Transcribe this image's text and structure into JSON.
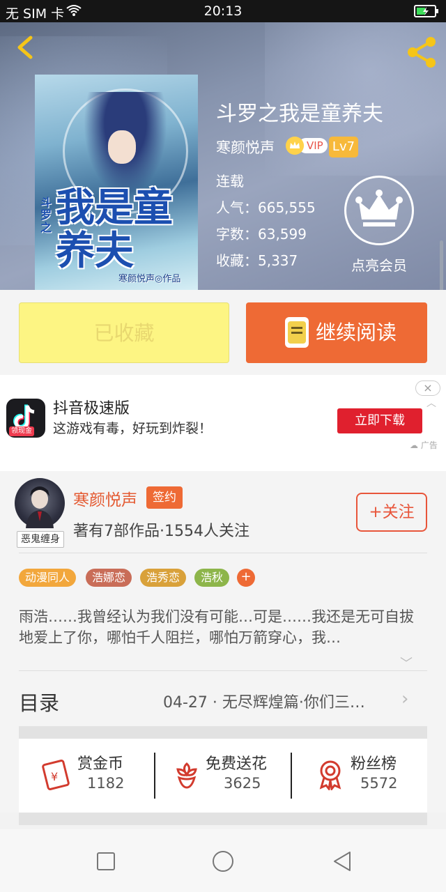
{
  "status_bar": {
    "carrier": "无 SIM 卡",
    "time": "20:13"
  },
  "book": {
    "title": "斗罗之我是童养夫",
    "author": "寒颜悦声",
    "vip_label": "VIP",
    "level": "Lv7",
    "status": "连载",
    "popularity": "人气：665,555",
    "word_count": "字数：63,599",
    "favorites": "收藏：5,337",
    "member_label": "点亮会员",
    "cover_title": "我是童养夫",
    "cover_side": "斗罗之",
    "cover_author": "寒颜悦声◎作品"
  },
  "actions": {
    "collected_label": "已收藏",
    "read_label": "继续阅读"
  },
  "ad": {
    "app_name": "抖音极速版",
    "description": "这游戏有毒，好玩到炸裂！",
    "button_label": "立即下载",
    "icon_tag": "领现金",
    "ad_label": "广告"
  },
  "author_card": {
    "name": "寒颜悦声",
    "sign_label": "签约",
    "avatar_tag": "恶鬼缠身",
    "works": "著有7部作品·1554人关注",
    "follow_label": "+关注",
    "tags": [
      {
        "label": "动漫同人",
        "color": "#f2a73c"
      },
      {
        "label": "浩娜恋",
        "color": "#c96d58"
      },
      {
        "label": "浩秀恋",
        "color": "#d9a13a"
      },
      {
        "label": "浩秋",
        "color": "#8db54a"
      }
    ],
    "tag_add": "+",
    "intro": "雨浩……我曾经认为我们没有可能…可是……我还是无可自拔地爱上了你，哪怕千人阻拦，哪怕万箭穿心，我…"
  },
  "toc": {
    "label": "目录",
    "latest": "04-27 · 无尽辉煌篇·你们三…"
  },
  "rewards": [
    {
      "title": "赏金币",
      "count": "1182",
      "icon": "red-envelope-icon"
    },
    {
      "title": "免费送花",
      "count": "3625",
      "icon": "flower-icon"
    },
    {
      "title": "粉丝榜",
      "count": "5572",
      "icon": "medal-icon"
    }
  ],
  "colors": {
    "accent": "#ee6a35",
    "collected_bg": "#fdf583",
    "ad_button": "#e0202e"
  }
}
